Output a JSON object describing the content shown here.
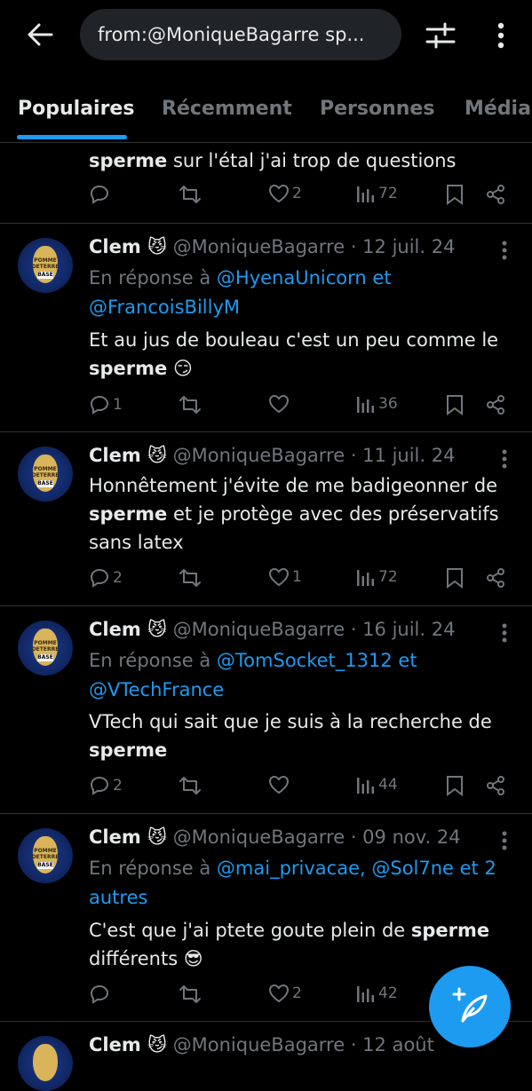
{
  "search": {
    "query": "from:@MoniqueBagarre sp..."
  },
  "tabs": [
    "Populaires",
    "Récemment",
    "Personnes",
    "Médias"
  ],
  "first_partial": {
    "bold": "sperme",
    "rest": " sur l'étal j'ai trop de questions",
    "likes": "2",
    "views": "72"
  },
  "tweets": [
    {
      "name": "Clem 😼",
      "handle": "@MoniqueBagarre",
      "date": "· 12 juil. 24",
      "reply_prefix": "En réponse à ",
      "reply_line1": "@HyenaUnicorn et",
      "reply_line2": "@FrancoisBillyM",
      "text_a": "Et au jus de bouleau c'est un peu comme le",
      "text_bold": "sperme",
      "text_b": " 😏",
      "replies": "1",
      "likes": "",
      "views": "36"
    },
    {
      "name": "Clem 😼",
      "handle": "@MoniqueBagarre",
      "date": "· 11 juil. 24",
      "text_a": "Honnêtement j'évite de me badigeonner de",
      "text_bold": "sperme",
      "text_b": " et je protège avec des préservatifs",
      "text_c": "sans latex",
      "replies": "2",
      "likes": "1",
      "views": "72"
    },
    {
      "name": "Clem 😼",
      "handle": "@MoniqueBagarre",
      "date": "· 16 juil. 24",
      "reply_prefix": "En réponse à ",
      "reply_line1": "@TomSocket_1312 et",
      "reply_line2": "@VTechFrance",
      "text_a": "VTech qui sait que je suis à la recherche de",
      "text_bold": "sperme",
      "replies": "2",
      "likes": "",
      "views": "44"
    },
    {
      "name": "Clem 😼",
      "handle": "@MoniqueBagarre",
      "date": "· 09 nov. 24",
      "reply_prefix": "En réponse à ",
      "reply_line1": "@mai_privacae, @Sol7ne et 2",
      "reply_line2": "autres",
      "text_a": "C'est que j'ai ptete goute plein de ",
      "text_bold": "sperme",
      "text_b": "différents 😎",
      "replies": "",
      "likes": "2",
      "views": "42"
    },
    {
      "name": "Clem 😼",
      "handle": "@MoniqueBagarre",
      "date": "· 12 août"
    }
  ],
  "avatar_text": {
    "top": "POMME DETERRE",
    "base": "BASE"
  },
  "colors": {
    "background": "#000000",
    "accent": "#1d9bf0",
    "muted": "#71767b",
    "text": "#e7e9ea",
    "divider": "#2f3336"
  }
}
